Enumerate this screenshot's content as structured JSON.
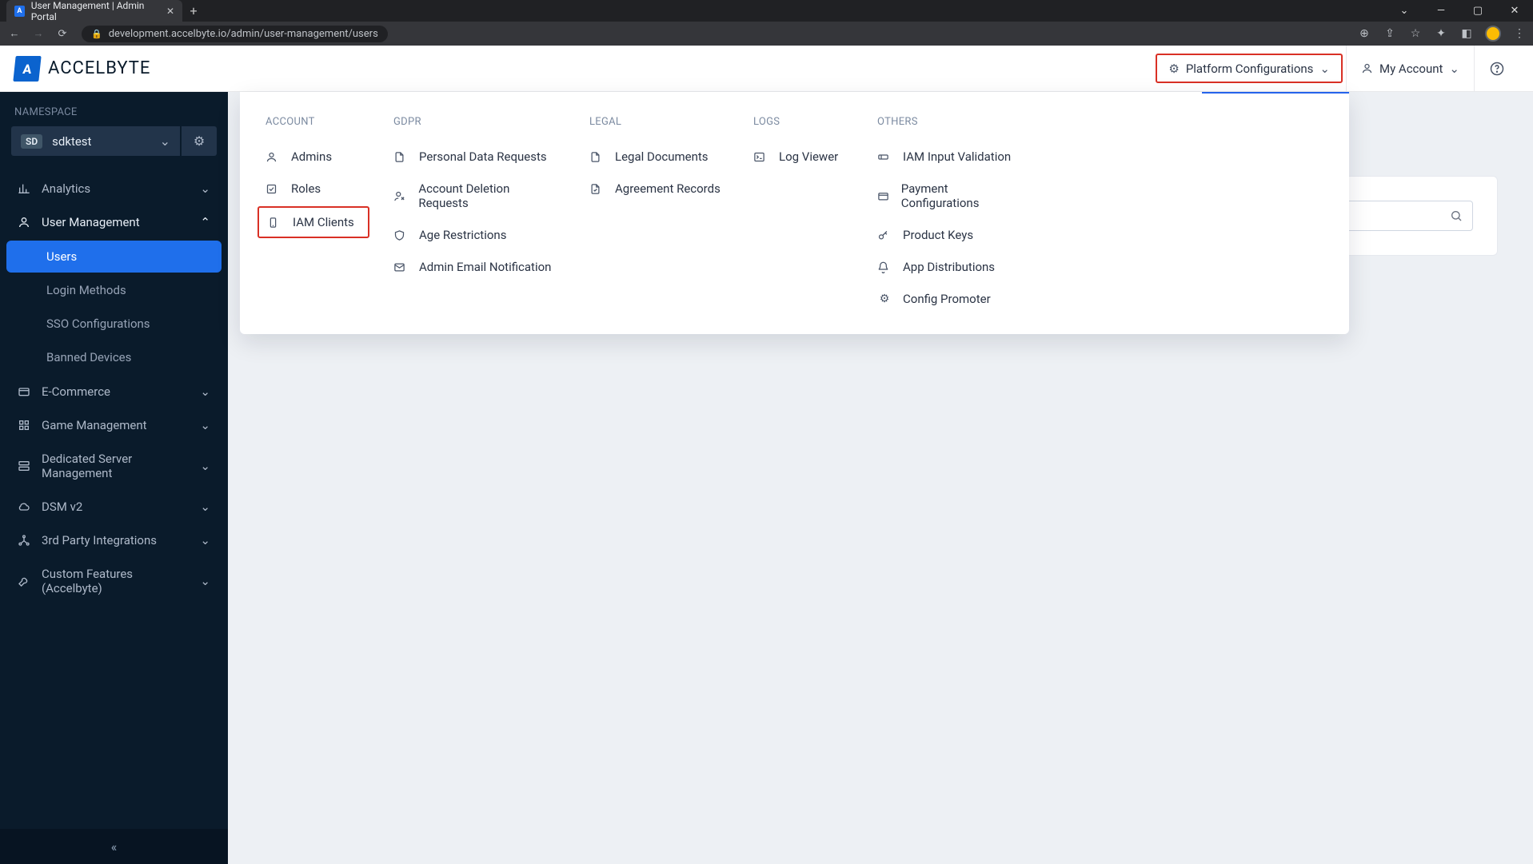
{
  "browser": {
    "tab_title": "User Management | Admin Portal",
    "url": "development.accelbyte.io/admin/user-management/users"
  },
  "logo_text": "ACCELBYTE",
  "topbar": {
    "platform_config": "Platform Configurations",
    "my_account": "My Account"
  },
  "sidebar": {
    "namespace_label": "NAMESPACE",
    "namespace_badge": "SD",
    "namespace_name": "sdktest",
    "items": [
      {
        "label": "Analytics"
      },
      {
        "label": "User Management"
      },
      {
        "label": "E-Commerce"
      },
      {
        "label": "Game Management"
      },
      {
        "label": "Dedicated Server Management"
      },
      {
        "label": "DSM v2"
      },
      {
        "label": "3rd Party Integrations"
      },
      {
        "label": "Custom Features (Accelbyte)"
      }
    ],
    "user_mgmt_sub": [
      {
        "label": "Users"
      },
      {
        "label": "Login Methods"
      },
      {
        "label": "SSO Configurations"
      },
      {
        "label": "Banned Devices"
      }
    ]
  },
  "mega": {
    "account": {
      "head": "ACCOUNT",
      "items": [
        "Admins",
        "Roles",
        "IAM Clients"
      ]
    },
    "gdpr": {
      "head": "GDPR",
      "items": [
        "Personal Data Requests",
        "Account Deletion Requests",
        "Age Restrictions",
        "Admin Email Notification"
      ]
    },
    "legal": {
      "head": "LEGAL",
      "items": [
        "Legal Documents",
        "Agreement Records"
      ]
    },
    "logs": {
      "head": "LOGS",
      "items": [
        "Log Viewer"
      ]
    },
    "others": {
      "head": "OTHERS",
      "items": [
        "IAM Input Validation",
        "Payment Configurations",
        "Product Keys",
        "App Distributions",
        "Config Promoter"
      ]
    }
  }
}
